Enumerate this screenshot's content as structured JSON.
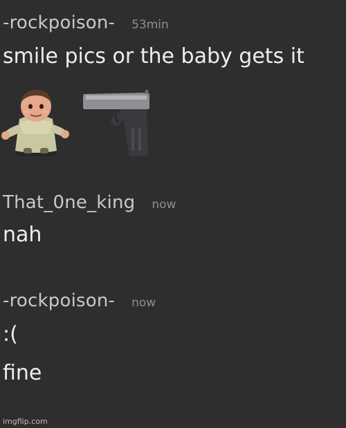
{
  "messages": [
    {
      "username": "-rockpoison-",
      "timestamp": "53min",
      "lines": [
        "smile pics or the baby gets it"
      ],
      "emojis": [
        "baby-emoji",
        "pistol-emoji"
      ]
    },
    {
      "username": "That_0ne_king",
      "timestamp": "now",
      "lines": [
        "nah"
      ]
    },
    {
      "username": "-rockpoison-",
      "timestamp": "now",
      "lines": [
        ":(",
        "fine"
      ]
    }
  ],
  "watermark": "imgflip.com",
  "colors": {
    "background": "#2e2e2e",
    "username": "#c9c9c9",
    "timestamp": "#8f8f8f",
    "message_text": "#eeeeee"
  }
}
